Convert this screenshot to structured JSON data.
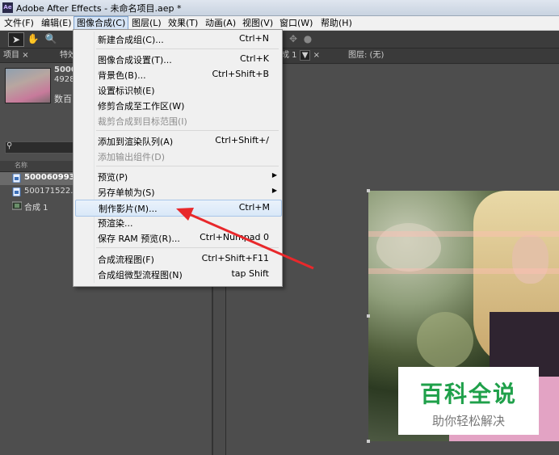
{
  "window": {
    "title": "Adobe After Effects - 未命名项目.aep *",
    "app_icon": "Ae"
  },
  "menubar": {
    "items": [
      {
        "label": "文件(F)"
      },
      {
        "label": "编辑(E)"
      },
      {
        "label": "图像合成(C)",
        "active": true
      },
      {
        "label": "图层(L)"
      },
      {
        "label": "效果(T)"
      },
      {
        "label": "动画(A)"
      },
      {
        "label": "视图(V)"
      },
      {
        "label": "窗口(W)"
      },
      {
        "label": "帮助(H)"
      }
    ]
  },
  "left_panel": {
    "tabs": [
      "项目",
      "特效"
    ],
    "close_glyph": "×",
    "info_name": "5000",
    "info_size": "4928",
    "info_extra": "数百",
    "column_name": "名称",
    "items": [
      {
        "label": "500060993.j",
        "icon": "image-file-icon",
        "selected": true
      },
      {
        "label": "500171522.jp",
        "icon": "image-file-icon"
      },
      {
        "label": "合成 1",
        "icon": "composition-icon"
      }
    ]
  },
  "viewer": {
    "comp_tab": "成 1",
    "layer_tab": "图层: (无)"
  },
  "dropdown_menu": {
    "items": [
      {
        "label": "新建合成组(C)...",
        "shortcut": "Ctrl+N"
      },
      {
        "label": "图像合成设置(T)...",
        "shortcut": "Ctrl+K"
      },
      {
        "label": "背景色(B)...",
        "shortcut": "Ctrl+Shift+B"
      },
      {
        "label": "设置标识帧(E)",
        "shortcut": ""
      },
      {
        "label": "修剪合成至工作区(W)",
        "shortcut": ""
      },
      {
        "label": "裁剪合成到目标范围(I)",
        "shortcut": "",
        "disabled": true
      },
      {
        "label": "添加到渲染队列(A)",
        "shortcut": "Ctrl+Shift+/"
      },
      {
        "label": "添加输出组件(D)",
        "shortcut": "",
        "disabled": true
      },
      {
        "label": "预览(P)",
        "shortcut": "",
        "submenu": true
      },
      {
        "label": "另存单帧为(S)",
        "shortcut": "",
        "submenu": true
      },
      {
        "label": "制作影片(M)...",
        "shortcut": "Ctrl+M",
        "highlighted": true
      },
      {
        "label": "预渲染...",
        "shortcut": ""
      },
      {
        "label": "保存 RAM 预览(R)...",
        "shortcut": "Ctrl+Numpad 0"
      },
      {
        "label": "合成流程图(F)",
        "shortcut": "Ctrl+Shift+F11"
      },
      {
        "label": "合成组微型流程图(N)",
        "shortcut": "tap Shift"
      }
    ]
  },
  "watermark": {
    "line1": "百科全说",
    "line2": "助你轻松解决"
  },
  "colors": {
    "annotation_arrow": "#e8282b",
    "highlight": "#d9e8f8"
  }
}
